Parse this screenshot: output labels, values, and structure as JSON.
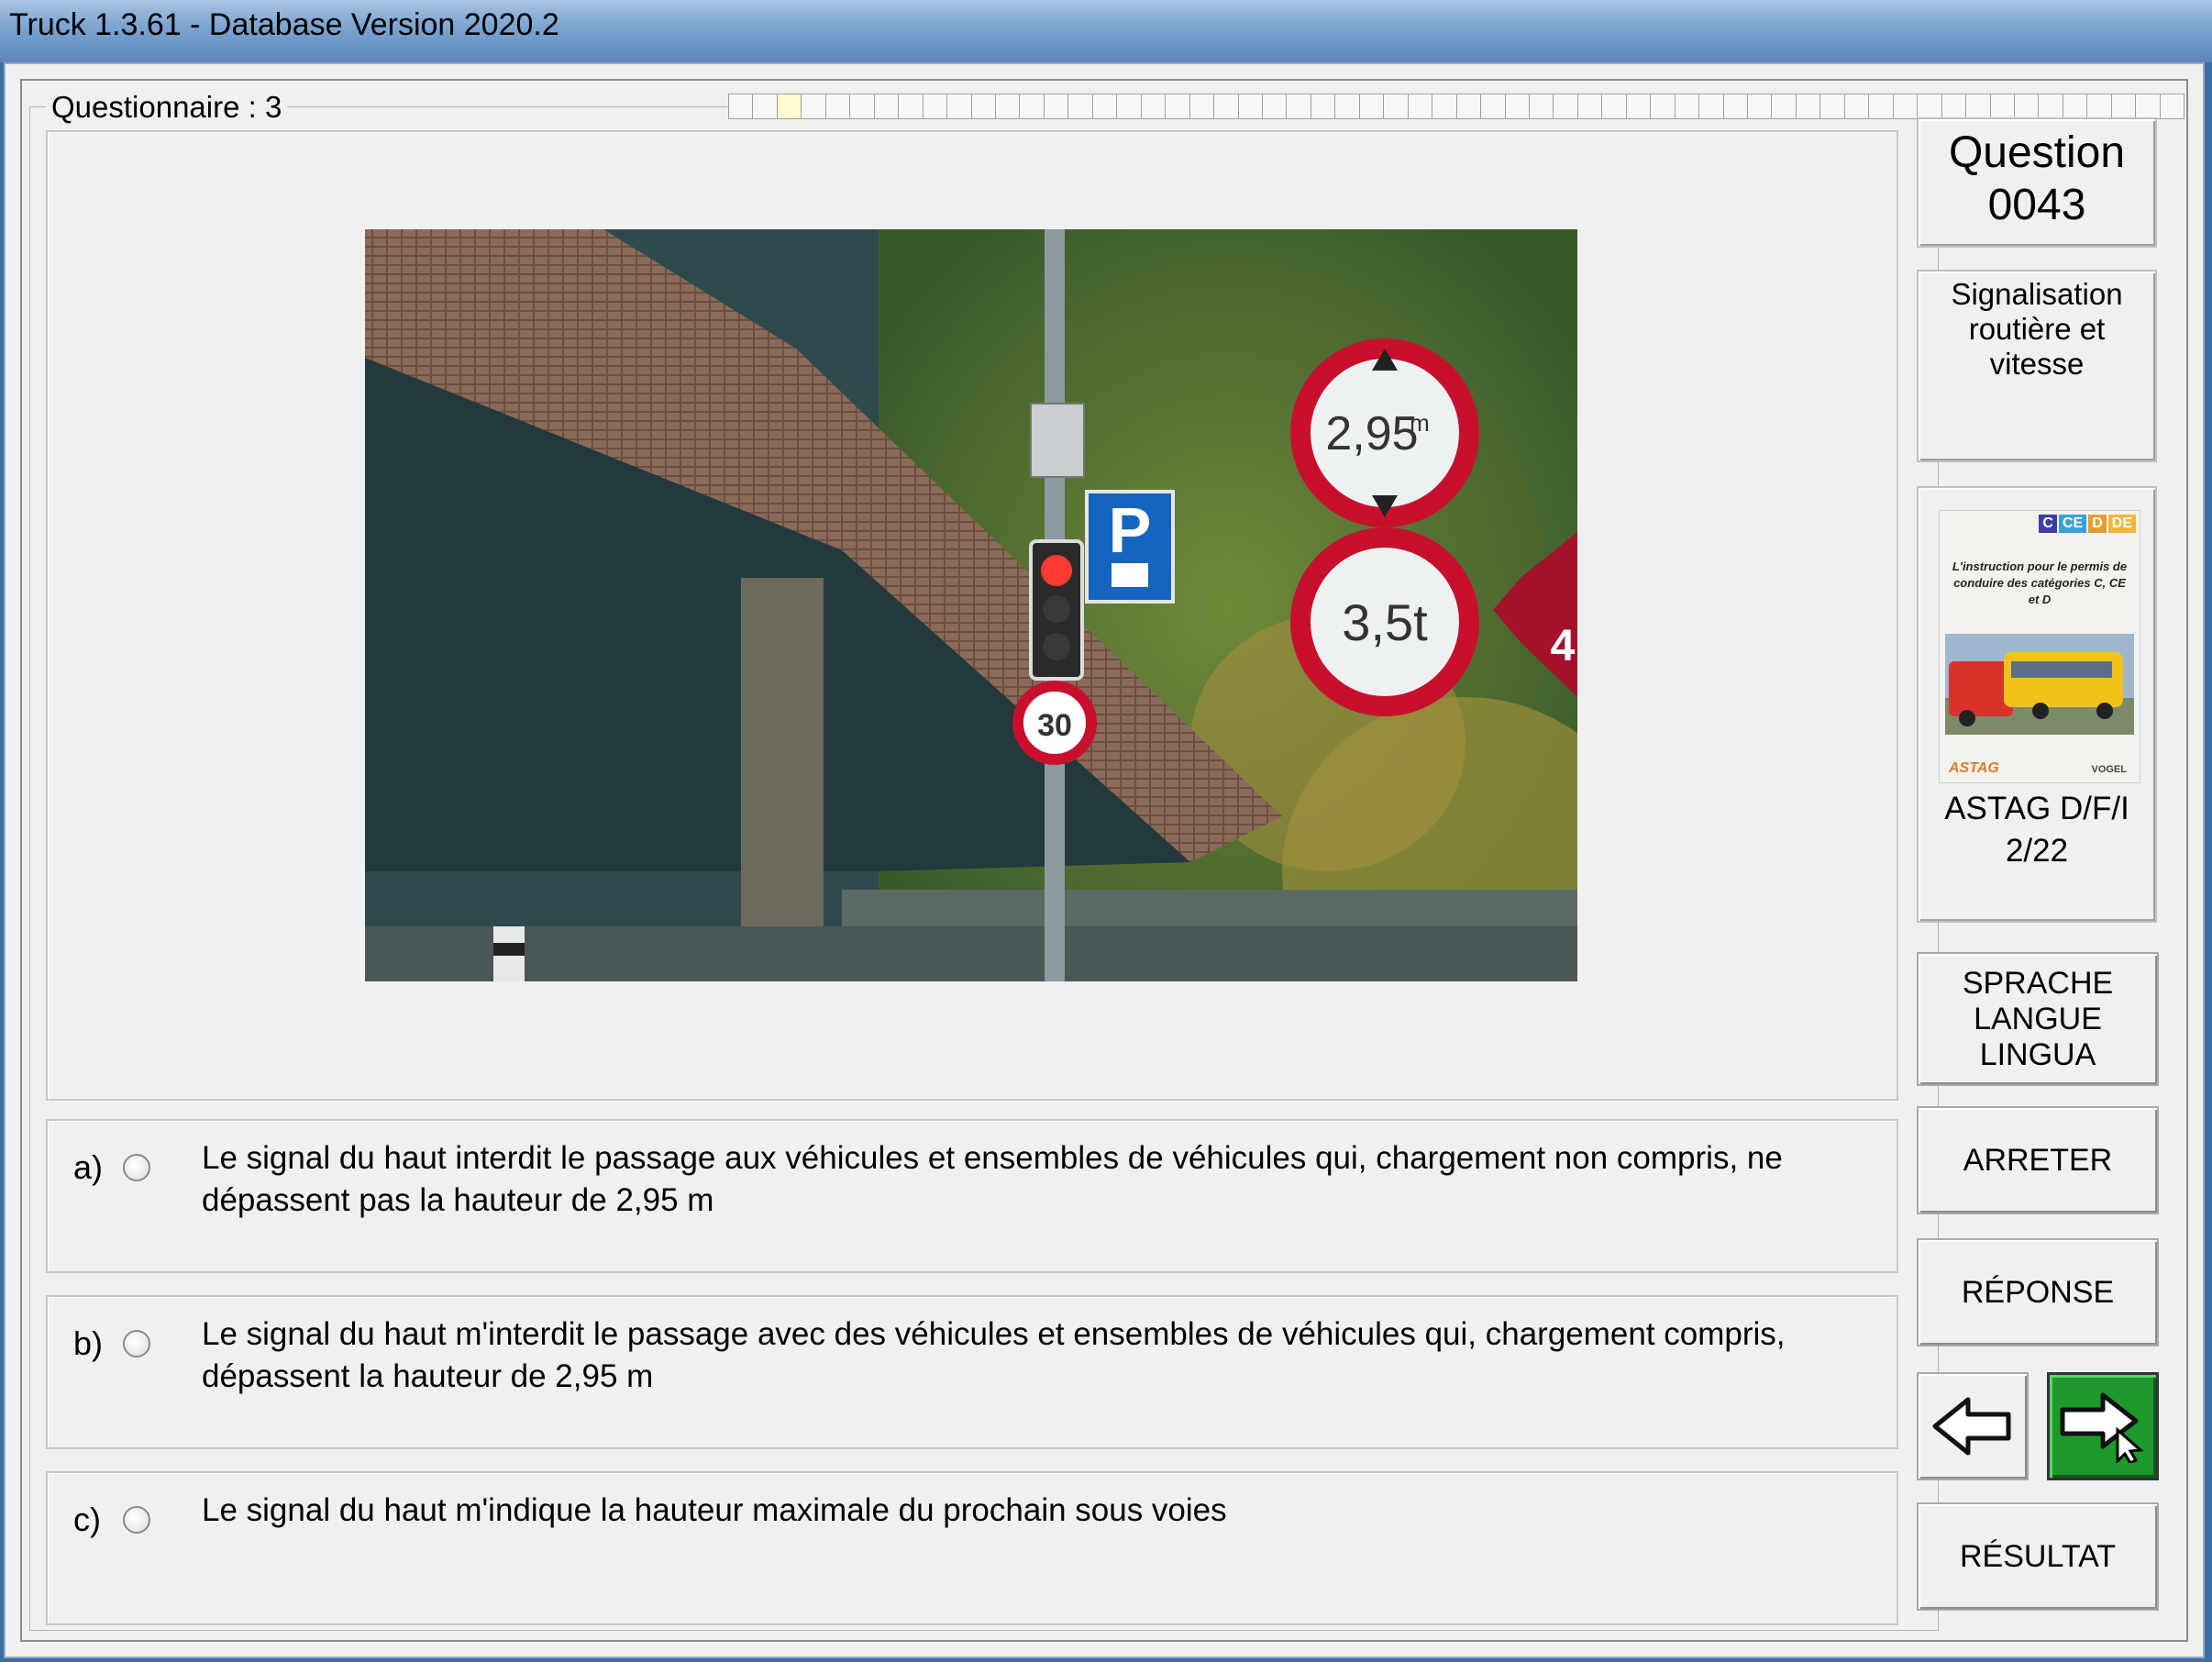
{
  "window": {
    "title": "Truck 1.3.61 - Database Version 2020.2"
  },
  "questionnaire": {
    "label": "Questionnaire : 3",
    "total_questions": 60,
    "current_question_index": 3
  },
  "question": {
    "label": "Question",
    "number": "0043",
    "category": "Signalisation routière et vitesse"
  },
  "photo": {
    "sign_height": "2,95",
    "sign_height_unit": "m",
    "sign_weight": "3,5t",
    "speed_sign": "30",
    "parking_sign": "P",
    "partial_sign": "4"
  },
  "answers": [
    {
      "letter": "a)",
      "text": "Le signal du haut interdit le passage aux véhicules et ensembles de véhicules qui, chargement non compris, ne dépassent pas la hauteur de 2,95 m",
      "selected": false
    },
    {
      "letter": "b)",
      "text": "Le signal du haut m'interdit le passage avec des  véhicules et ensembles de véhicules qui, chargement compris, dépassent la hauteur de 2,95 m",
      "selected": false
    },
    {
      "letter": "c)",
      "text": "Le signal du haut m'indique la hauteur maximale du prochain sous voies",
      "selected": false
    }
  ],
  "book": {
    "badges": [
      {
        "text": "C",
        "color": "#3b3ea6"
      },
      {
        "text": "CE",
        "color": "#3aa0d8"
      },
      {
        "text": "D",
        "color": "#e89b2f"
      },
      {
        "text": "DE",
        "color": "#f2b63b"
      }
    ],
    "intro": "L'instruction pour le permis de conduire des catégories C, CE et D",
    "publisher_left": "ASTAG",
    "publisher_right": "VOGEL",
    "reference_line1": "ASTAG D/F/I",
    "reference_line2": "2/22"
  },
  "buttons": {
    "language": "SPRACHE\nLANGUE\nLINGUA",
    "stop": "ARRETER",
    "answer": "RÉPONSE",
    "result": "RÉSULTAT"
  },
  "colors": {
    "next_button": "#1e9a2c",
    "sign_red": "#c8102e",
    "parking_blue": "#1565c0"
  }
}
